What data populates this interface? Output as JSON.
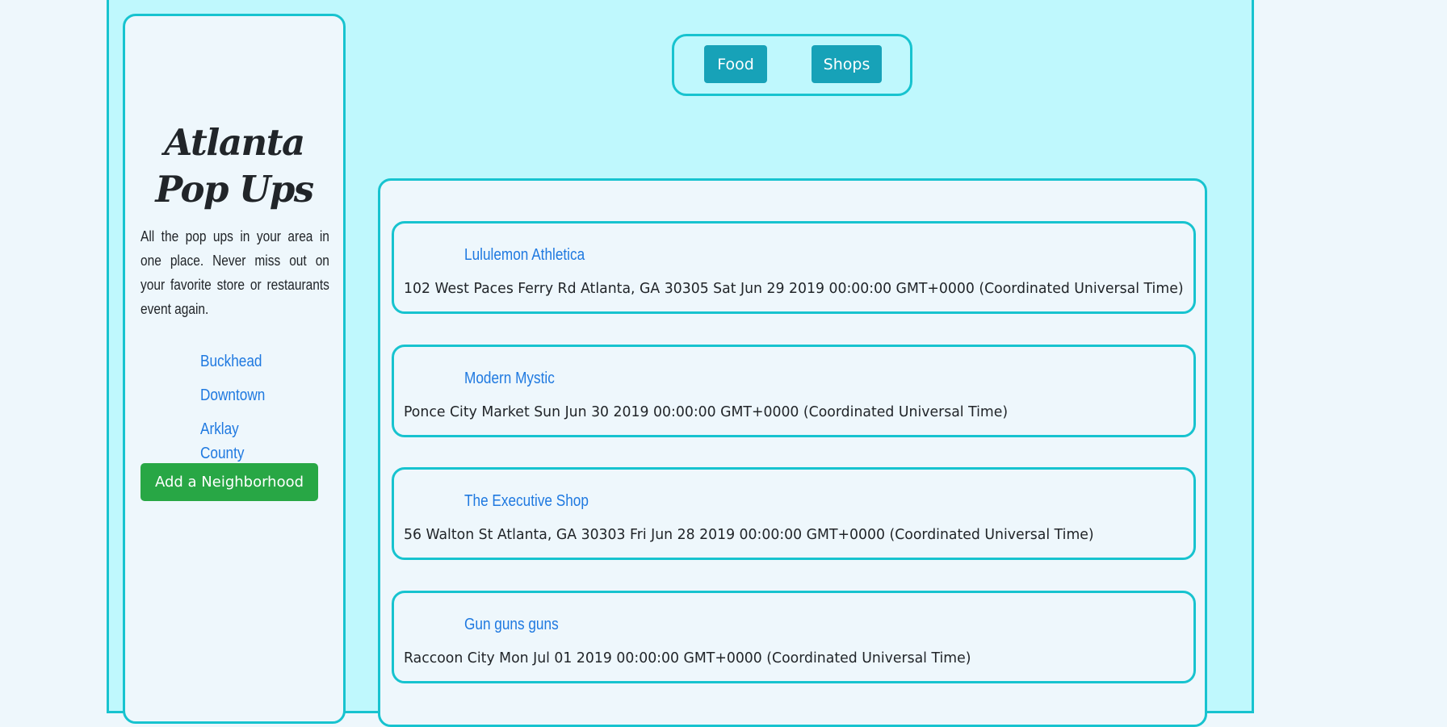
{
  "sidebar": {
    "title": "Atlanta Pop Ups",
    "description": "All the pop ups in your area in one place. Never miss out on your favorite store or restaurants event again.",
    "neighborhoods": [
      "Buckhead",
      "Downtown",
      "Arklay County"
    ],
    "add_button": "Add a Neighborhood"
  },
  "filters": {
    "food": "Food",
    "shops": "Shops"
  },
  "events": [
    {
      "name": "Lululemon Athletica",
      "detail": "102 West Paces Ferry Rd Atlanta, GA 30305 Sat Jun 29 2019 00:00:00 GMT+0000 (Coordinated Universal Time)"
    },
    {
      "name": "Modern Mystic",
      "detail": "Ponce City Market Sun Jun 30 2019 00:00:00 GMT+0000 (Coordinated Universal Time)"
    },
    {
      "name": "The Executive Shop",
      "detail": "56 Walton St Atlanta, GA 30303 Fri Jun 28 2019 00:00:00 GMT+0000 (Coordinated Universal Time)"
    },
    {
      "name": "Gun guns guns",
      "detail": "Raccoon City Mon Jul 01 2019 00:00:00 GMT+0000 (Coordinated Universal Time)"
    }
  ],
  "colors": {
    "accent_border": "#17c3cf",
    "page_background": "#bff8fd",
    "panel_background": "#eef7fc",
    "link": "#1f79e0",
    "filter_button": "#17a2b8",
    "add_button": "#28a745"
  }
}
